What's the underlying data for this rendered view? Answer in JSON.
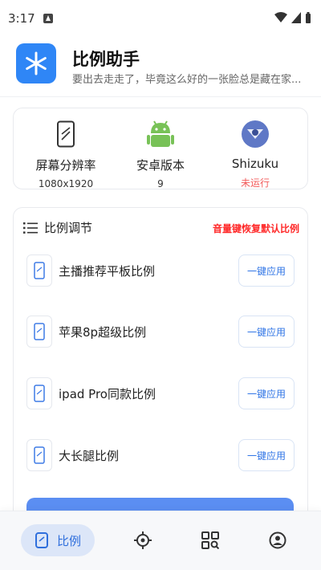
{
  "status_bar": {
    "time": "3:17"
  },
  "header": {
    "app_name": "比例助手",
    "subtitle": "要出去走走了，毕竟这么好的一张脸总是藏在家..."
  },
  "info": [
    {
      "icon": "phone-screen-icon",
      "label": "屏幕分辨率",
      "value": "1080x1920"
    },
    {
      "icon": "android-icon",
      "label": "安卓版本",
      "value": "9"
    },
    {
      "icon": "shizuku-icon",
      "label": "Shizuku",
      "value": "未运行",
      "value_color": "#f25b5b"
    }
  ],
  "ratio_section": {
    "title": "比例调节",
    "hint": "音量键恢复默认比例",
    "items": [
      {
        "label": "主播推荐平板比例",
        "button": "一键应用"
      },
      {
        "label": "苹果8p超级比例",
        "button": "一键应用"
      },
      {
        "label": "ipad Pro同款比例",
        "button": "一键应用"
      },
      {
        "label": "大长腿比例",
        "button": "一键应用"
      }
    ]
  },
  "bottom_nav": {
    "active_label": "比例",
    "items": [
      "ratio-icon",
      "target-icon",
      "apps-search-icon",
      "profile-icon"
    ]
  },
  "colors": {
    "accent": "#2f86f6",
    "hint_red": "#ff2a2a",
    "nav_active_bg": "#dce6f8"
  }
}
